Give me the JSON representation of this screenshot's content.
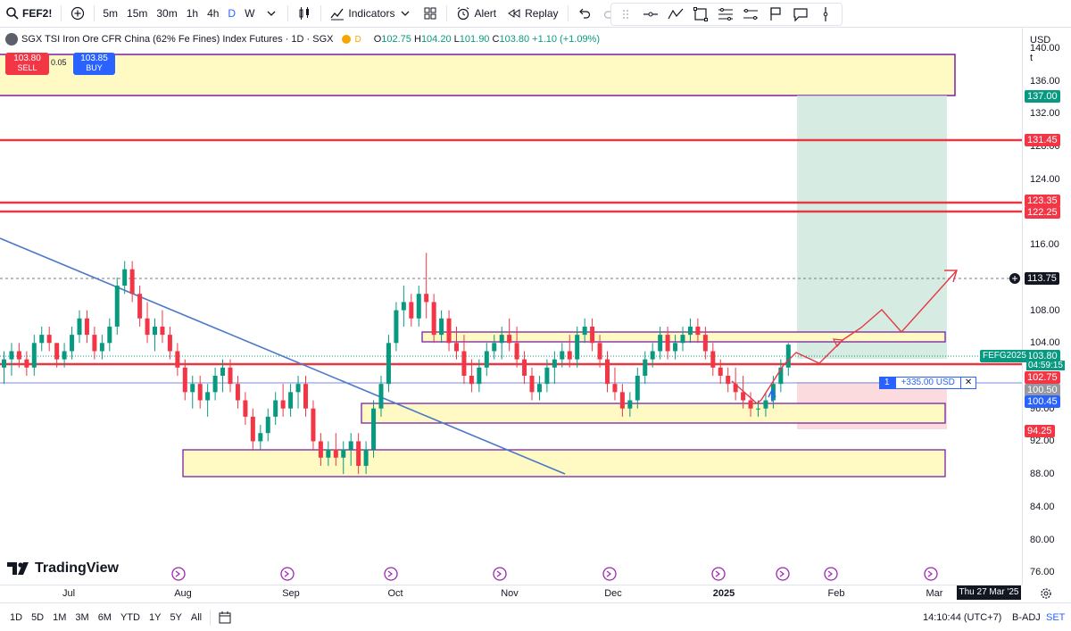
{
  "toolbar": {
    "symbol": "FEF2!",
    "intervals": [
      "5m",
      "15m",
      "30m",
      "1h",
      "4h",
      "D",
      "W"
    ],
    "active_interval": "D",
    "indicators_label": "Indicators",
    "alert_label": "Alert",
    "replay_label": "Replay"
  },
  "legend": {
    "title": "SGX TSI Iron Ore CFR China (62% Fe Fines) Index Futures · 1D · SGX",
    "badge": "D",
    "open_label": "O",
    "open": "102.75",
    "high_label": "H",
    "high": "104.20",
    "low_label": "L",
    "low": "101.90",
    "close_label": "C",
    "close": "103.80",
    "change": "+1.10 (+1.09%)"
  },
  "trade": {
    "sell_price": "103.80",
    "sell_label": "SELL",
    "spread": "0.05",
    "buy_price": "103.85",
    "buy_label": "BUY"
  },
  "price_axis": {
    "currency": "USD",
    "unit": "t",
    "ticks": [
      "140.00",
      "136.00",
      "132.00",
      "128.00",
      "124.00",
      "120.00",
      "116.00",
      "112.00",
      "108.00",
      "104.00",
      "100.00",
      "96.00",
      "92.00",
      "88.00",
      "84.00",
      "80.00",
      "76.00"
    ],
    "badges": {
      "target": "137.00",
      "level_1": "131.45",
      "level_2": "123.35",
      "level_3": "122.25",
      "crosshair": "113.75",
      "symbol_tag": "FEFG2025",
      "last": "103.80",
      "countdown": "04:59:15",
      "support": "102.75",
      "entry": "100.50",
      "entry_2": "100.45",
      "stop": "94.25"
    }
  },
  "position": {
    "qty": "1",
    "pnl": "+335.00 USD",
    "close": "✕"
  },
  "time_axis": {
    "months": [
      "Jul",
      "Aug",
      "Sep",
      "Oct",
      "Nov",
      "Dec",
      "2025",
      "Feb",
      "Mar"
    ],
    "current_date": "Thu 27 Mar '25"
  },
  "bottom": {
    "ranges": [
      "1D",
      "5D",
      "1M",
      "3M",
      "6M",
      "YTD",
      "1Y",
      "5Y",
      "All"
    ],
    "clock": "14:10:44 (UTC+7)",
    "adjust": "B-ADJ",
    "set": "SET"
  },
  "logo": "TradingView",
  "colors": {
    "up": "#089981",
    "down": "#f23645",
    "accent": "#2962ff",
    "zone": "#fff9c4",
    "zone_border": "#7b1fa2"
  },
  "chart_data": {
    "type": "candlestick",
    "price_range": [
      74.5,
      142.5
    ],
    "candles": [
      [
        101,
        103,
        99,
        102
      ],
      [
        102,
        104,
        100,
        103
      ],
      [
        103,
        104,
        101,
        102
      ],
      [
        102,
        103,
        100,
        101
      ],
      [
        101,
        105,
        100,
        104
      ],
      [
        104,
        106,
        103,
        105
      ],
      [
        105,
        106,
        103,
        104
      ],
      [
        104,
        104,
        101,
        102
      ],
      [
        102,
        104,
        101,
        103
      ],
      [
        103,
        106,
        102,
        105
      ],
      [
        105,
        108,
        104,
        107
      ],
      [
        107,
        108,
        104,
        105
      ],
      [
        105,
        106,
        102,
        103
      ],
      [
        103,
        105,
        102,
        104
      ],
      [
        104,
        107,
        103,
        106
      ],
      [
        106,
        112,
        105,
        111
      ],
      [
        111,
        114,
        110,
        113
      ],
      [
        113,
        114,
        109,
        110
      ],
      [
        110,
        111,
        106,
        107
      ],
      [
        107,
        109,
        104,
        105
      ],
      [
        105,
        107,
        103,
        106
      ],
      [
        106,
        108,
        104,
        105
      ],
      [
        105,
        106,
        102,
        103
      ],
      [
        103,
        104,
        100,
        101
      ],
      [
        101,
        102,
        97,
        98
      ],
      [
        98,
        100,
        96,
        99
      ],
      [
        99,
        100,
        96,
        97
      ],
      [
        97,
        99,
        95,
        98
      ],
      [
        98,
        101,
        97,
        100
      ],
      [
        100,
        102,
        98,
        101
      ],
      [
        101,
        102,
        98,
        99
      ],
      [
        99,
        100,
        96,
        97
      ],
      [
        97,
        98,
        94,
        95
      ],
      [
        95,
        96,
        91,
        92
      ],
      [
        92,
        94,
        91,
        93
      ],
      [
        93,
        96,
        92,
        95
      ],
      [
        95,
        98,
        94,
        97
      ],
      [
        97,
        99,
        95,
        96
      ],
      [
        96,
        99,
        95,
        98
      ],
      [
        98,
        100,
        96,
        99
      ],
      [
        99,
        100,
        95,
        96
      ],
      [
        96,
        97,
        91,
        92
      ],
      [
        92,
        93,
        89,
        90
      ],
      [
        90,
        92,
        89,
        91
      ],
      [
        91,
        93,
        89,
        90
      ],
      [
        90,
        92,
        88,
        91
      ],
      [
        91,
        93,
        89,
        92
      ],
      [
        92,
        93,
        88,
        89
      ],
      [
        89,
        92,
        88,
        91
      ],
      [
        91,
        97,
        90,
        96
      ],
      [
        96,
        100,
        95,
        99
      ],
      [
        99,
        105,
        98,
        104
      ],
      [
        104,
        109,
        103,
        108
      ],
      [
        108,
        111,
        106,
        109
      ],
      [
        109,
        110,
        106,
        107
      ],
      [
        107,
        111,
        106,
        110
      ],
      [
        110,
        115,
        107,
        109
      ],
      [
        109,
        110,
        104,
        105
      ],
      [
        105,
        108,
        104,
        107
      ],
      [
        107,
        108,
        103,
        104
      ],
      [
        104,
        106,
        102,
        103
      ],
      [
        103,
        105,
        99,
        100
      ],
      [
        100,
        102,
        98,
        99
      ],
      [
        99,
        102,
        98,
        101
      ],
      [
        101,
        104,
        100,
        103
      ],
      [
        103,
        105,
        102,
        104
      ],
      [
        104,
        106,
        102,
        105
      ],
      [
        105,
        107,
        103,
        104
      ],
      [
        104,
        106,
        101,
        102
      ],
      [
        102,
        103,
        99,
        100
      ],
      [
        100,
        101,
        97,
        98
      ],
      [
        98,
        100,
        97,
        99
      ],
      [
        99,
        102,
        98,
        101
      ],
      [
        101,
        103,
        99,
        102
      ],
      [
        102,
        104,
        101,
        103
      ],
      [
        103,
        105,
        101,
        102
      ],
      [
        102,
        106,
        101,
        105
      ],
      [
        105,
        107,
        104,
        106
      ],
      [
        106,
        107,
        103,
        104
      ],
      [
        104,
        105,
        101,
        102
      ],
      [
        102,
        103,
        98,
        99
      ],
      [
        99,
        101,
        97,
        98
      ],
      [
        98,
        99,
        95,
        96
      ],
      [
        96,
        98,
        95,
        97
      ],
      [
        97,
        101,
        96,
        100
      ],
      [
        100,
        103,
        99,
        102
      ],
      [
        102,
        104,
        101,
        103
      ],
      [
        103,
        106,
        102,
        105
      ],
      [
        105,
        106,
        102,
        103
      ],
      [
        103,
        105,
        102,
        104
      ],
      [
        104,
        106,
        103,
        105
      ],
      [
        105,
        107,
        104,
        106
      ],
      [
        106,
        107,
        104,
        105
      ],
      [
        105,
        106,
        102,
        103
      ],
      [
        103,
        104,
        100,
        101
      ],
      [
        101,
        102,
        99,
        100
      ],
      [
        100,
        101,
        98,
        99
      ],
      [
        99,
        101,
        97,
        98
      ],
      [
        98,
        100,
        96,
        97
      ],
      [
        97,
        98,
        95,
        96
      ],
      [
        96,
        97,
        95,
        96
      ],
      [
        96,
        98,
        95,
        97
      ],
      [
        97,
        100,
        96,
        99
      ],
      [
        99,
        102,
        98,
        101
      ],
      [
        101,
        104,
        100,
        103.8
      ]
    ]
  }
}
